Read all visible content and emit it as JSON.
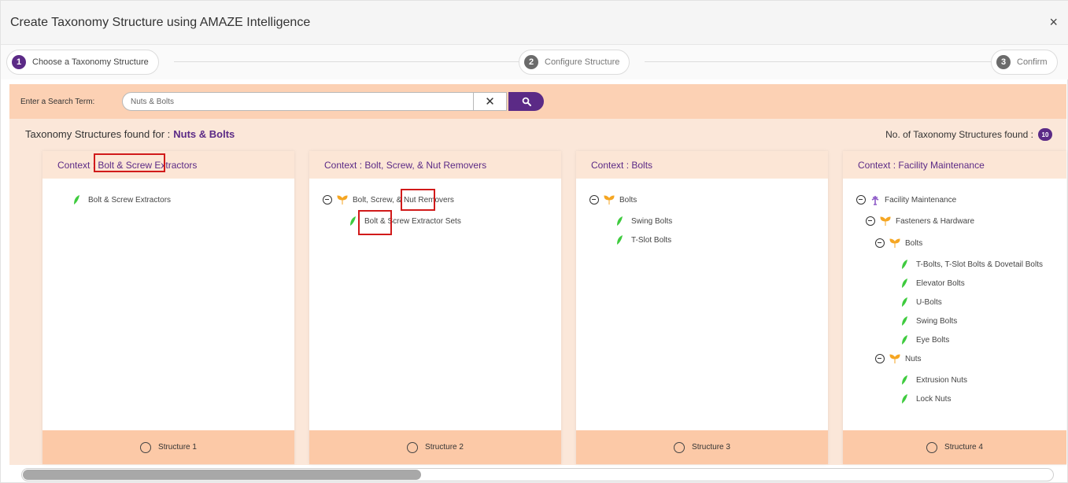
{
  "dialog": {
    "title": "Create Taxonomy Structure using AMAZE Intelligence",
    "close_label": "×"
  },
  "steps": [
    {
      "num": "1",
      "label": "Choose a Taxonomy Structure",
      "active": true
    },
    {
      "num": "2",
      "label": "Configure Structure",
      "active": false
    },
    {
      "num": "3",
      "label": "Confirm",
      "active": false
    }
  ],
  "search": {
    "label": "Enter a Search Term:",
    "value": "Nuts & Bolts",
    "clear_label": "✕"
  },
  "results": {
    "found_prefix": "Taxonomy Structures found for :",
    "found_term": "Nuts & Bolts",
    "count_label": "No. of Taxonomy Structures found :",
    "count": "10"
  },
  "cards": [
    {
      "context": "Context : Bolt & Screw Extractors",
      "structure": "Structure 1",
      "nodes": [
        "Bolt & Screw Extractors"
      ]
    },
    {
      "context": "Context : Bolt, Screw, & Nut Removers",
      "structure": "Structure 2",
      "nodes": [
        "Bolt, Screw, & Nut Removers",
        "Bolt & Screw Extractor Sets"
      ]
    },
    {
      "context": "Context : Bolts",
      "structure": "Structure 3",
      "nodes": [
        "Bolts",
        "Swing Bolts",
        "T-Slot Bolts"
      ]
    },
    {
      "context": "Context : Facility Maintenance",
      "structure": "Structure 4",
      "nodes": [
        "Facility Maintenance",
        "Fasteners & Hardware",
        "Bolts",
        "T-Bolts, T-Slot Bolts & Dovetail Bolts",
        "Elevator Bolts",
        "U-Bolts",
        "Swing Bolts",
        "Eye Bolts",
        "Nuts",
        "Extrusion Nuts",
        "Lock Nuts"
      ]
    }
  ],
  "colors": {
    "accent": "#5b2a86",
    "search_bg": "#fcd1b4",
    "card_footer": "#fcc9a7",
    "highlight": "#d11a1a"
  },
  "icons": {
    "leaf": "green-leaf-icon",
    "branch": "orange-sprout-icon",
    "root": "purple-tree-root-icon",
    "collapse": "minus-circle-icon",
    "search": "search-icon"
  }
}
